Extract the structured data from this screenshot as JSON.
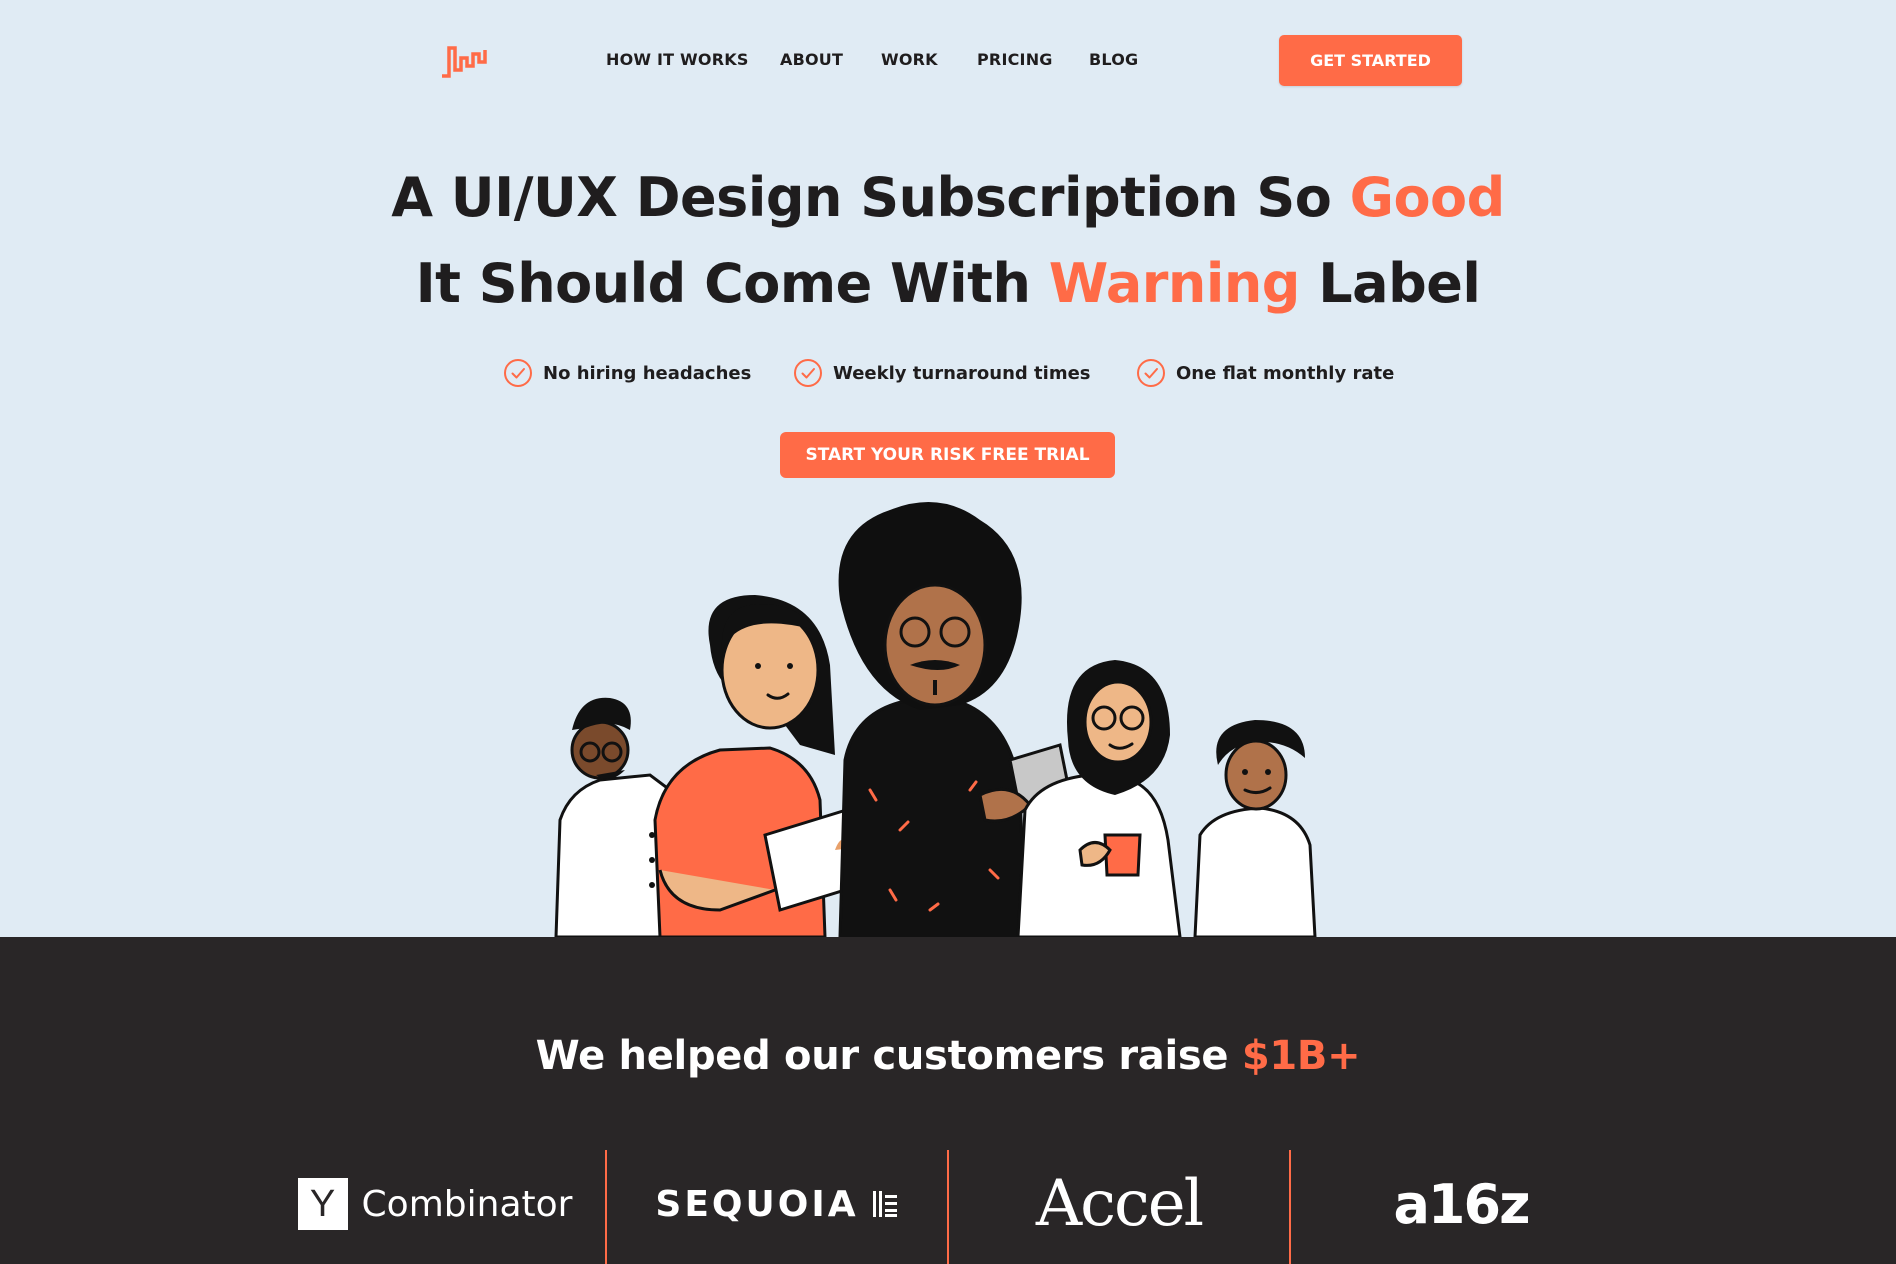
{
  "nav": {
    "logo_icon": "bar-pulse-logo-icon",
    "links": [
      "HOW IT WORKS",
      "ABOUT",
      "WORK",
      "PRICING",
      "BLOG"
    ],
    "cta_label": "GET STARTED"
  },
  "hero": {
    "headline_line1_part1": "A UI/UX Design Subscription So ",
    "headline_line1_accent": "Good",
    "headline_line2_part1": "It Should Come With ",
    "headline_line2_accent": "Warning",
    "headline_line2_part2": " Label",
    "checks": [
      "No hiring headaches",
      "Weekly turnaround times",
      "One flat monthly rate"
    ],
    "trial_label": "START YOUR RISK FREE TRIAL"
  },
  "investors": {
    "heading_part1": "We helped our customers raise ",
    "heading_accent": "$1B+",
    "logos": {
      "yc_box": "Y",
      "yc_word": "Combinator",
      "sequoia": "SEQUOIA",
      "accel": "Accel",
      "a16z": "a16z"
    }
  },
  "colors": {
    "accent": "#ff6b47",
    "hero_bg": "#e0ebf4",
    "dark_bg": "#292627",
    "text": "#1f1d1e"
  }
}
